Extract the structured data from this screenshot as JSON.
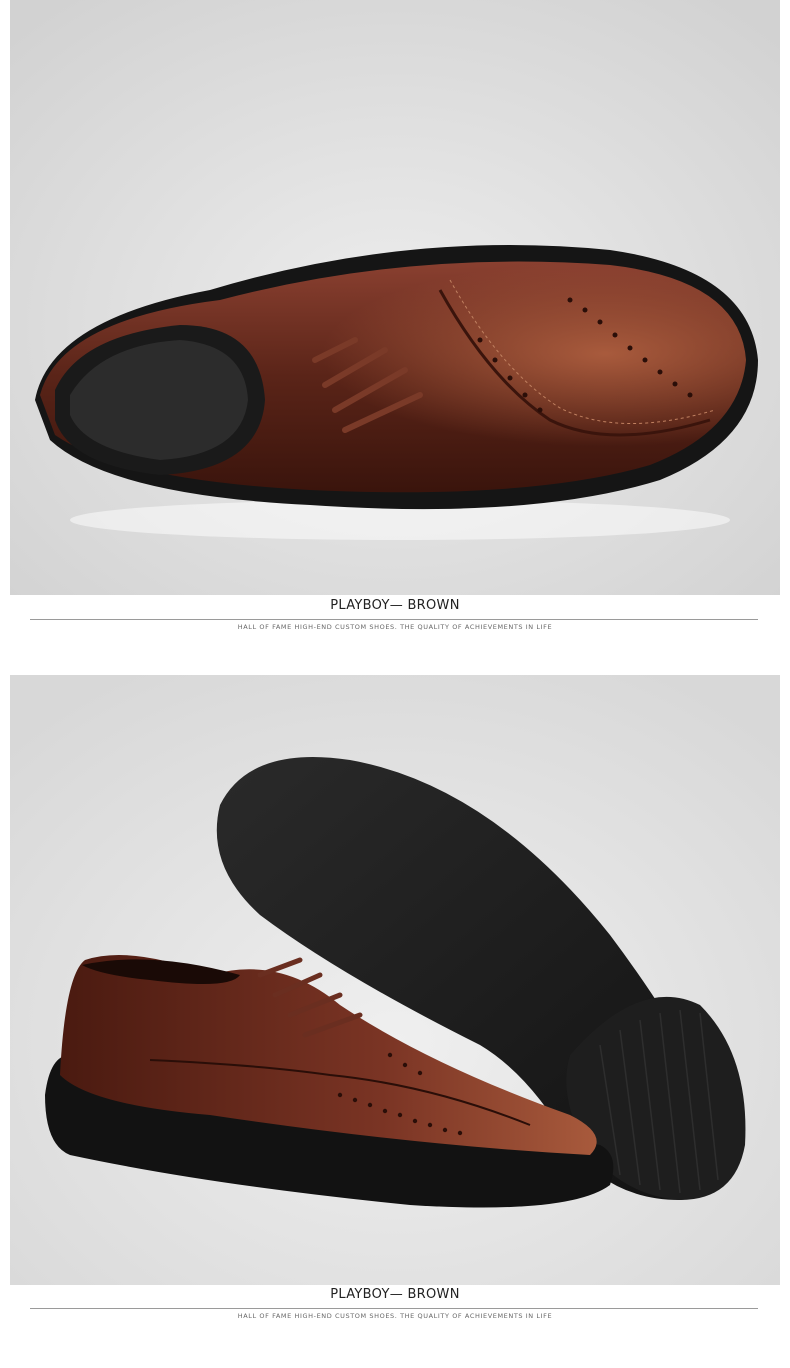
{
  "sections": [
    {
      "view": "top-side view of brown brogue oxford shoe",
      "caption": "PLAYBOY— BROWN",
      "tagline": "HALL OF FAME HIGH-END CUSTOM SHOES. THE QUALITY OF ACHIEVEMENTS IN LIFE"
    },
    {
      "view": "side view of brown brogue shoe with black rubber sole",
      "caption": "PLAYBOY— BROWN",
      "tagline": "HALL OF FAME HIGH-END CUSTOM SHOES. THE QUALITY OF ACHIEVEMENTS IN LIFE"
    }
  ],
  "colors": {
    "leather": "#5a2418",
    "leather_highlight": "#8a4030",
    "sole": "#1a1a1a",
    "background": "#e6e6e6"
  }
}
